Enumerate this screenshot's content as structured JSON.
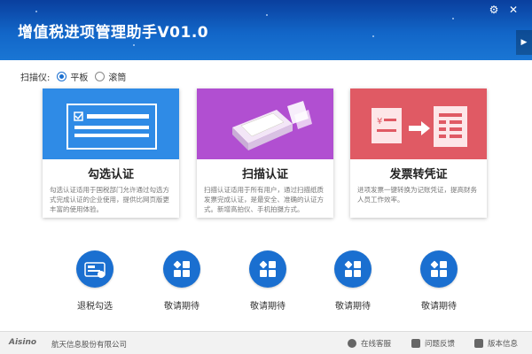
{
  "header": {
    "title": "增值税进项管理助手V01.0",
    "settings_icon": "gear-icon",
    "close_icon": "close-icon",
    "expand_icon": "chevron-right-icon"
  },
  "scanner": {
    "label": "扫描仪:",
    "options": [
      {
        "label": "平板",
        "selected": true
      },
      {
        "label": "滚筒",
        "selected": false
      }
    ]
  },
  "cards": [
    {
      "title": "勾选认证",
      "desc": "勾选认证适用于国税部门允许通过勾选方式完成认证的企业使用，提供比网页版更丰富的使用体验。",
      "color": "#2f8be6"
    },
    {
      "title": "扫描认证",
      "desc": "扫描认证适用于所有用户，通过扫描纸质发票完成认证，是最安全、准确的认证方式。新增高拍仪、手机拍摄方式。",
      "color": "#b14fd1"
    },
    {
      "title": "发票转凭证",
      "desc": "进项发票一键转换为记账凭证，提高财务人员工作效率。",
      "color": "#e05a64"
    }
  ],
  "functions": [
    {
      "label": "退税勾选",
      "icon": "tax-refund-icon"
    },
    {
      "label": "敬请期待",
      "icon": "apps-grid-icon"
    },
    {
      "label": "敬请期待",
      "icon": "apps-grid-icon"
    },
    {
      "label": "敬请期待",
      "icon": "apps-grid-icon"
    },
    {
      "label": "敬请期待",
      "icon": "apps-grid-icon"
    }
  ],
  "footer": {
    "brand": "Aisino",
    "company": "航天信息股份有限公司",
    "links": [
      {
        "label": "在线客服",
        "icon": "headset-icon"
      },
      {
        "label": "问题反馈",
        "icon": "feedback-icon"
      },
      {
        "label": "版本信息",
        "icon": "info-icon"
      }
    ]
  },
  "colors": {
    "header_blue": "#1266c8",
    "accent_blue": "#1a6fd0",
    "card_blue": "#2f8be6",
    "card_purple": "#b14fd1",
    "card_red": "#e05a64"
  }
}
